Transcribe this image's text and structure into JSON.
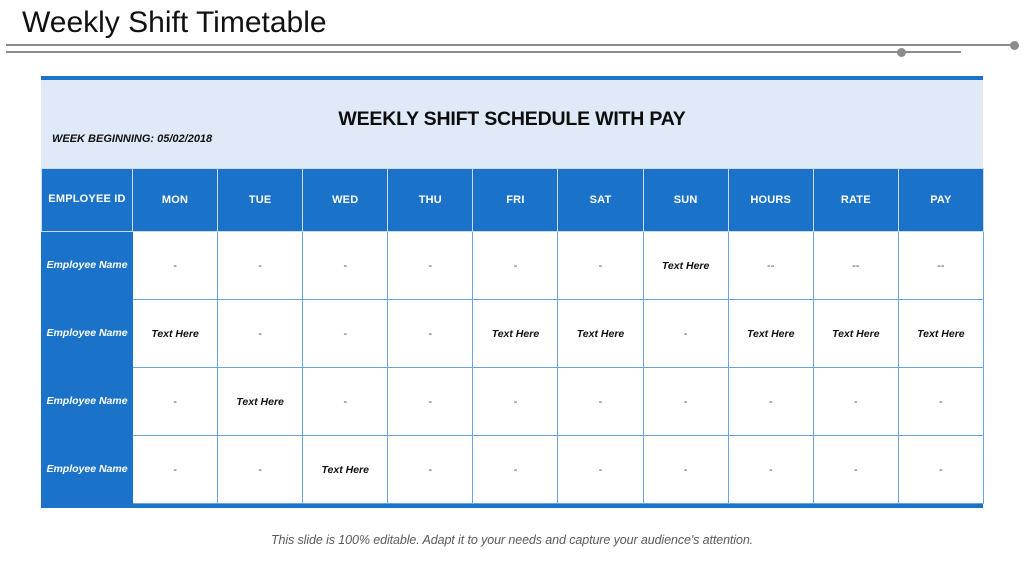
{
  "slide": {
    "title": "Weekly Shift Timetable",
    "footer_note": "This slide is 100% editable. Adapt it to your needs and capture your audience's attention."
  },
  "banner": {
    "heading": "WEEKLY SHIFT SCHEDULE WITH PAY",
    "week_beginning": "WEEK BEGINNING: 05/02/2018"
  },
  "colors": {
    "accent_blue": "#1b73c9",
    "banner_blue": "#dfe9f8",
    "grid_line": "#6ba4dd",
    "rule_gray": "#8c8c8c"
  },
  "table": {
    "headers": [
      "EMPLOYEE ID",
      "MON",
      "TUE",
      "WED",
      "THU",
      "FRI",
      "SAT",
      "SUN",
      "HOURS",
      "RATE",
      "PAY"
    ],
    "rows": [
      {
        "name": "Employee Name",
        "cells": [
          "-",
          "-",
          "-",
          "-",
          "-",
          "-",
          "Text Here",
          "--",
          "--",
          "--"
        ]
      },
      {
        "name": "Employee Name",
        "cells": [
          "Text Here",
          "-",
          "-",
          "-",
          "Text Here",
          "Text Here",
          "-",
          "Text Here",
          "Text Here",
          "Text Here"
        ]
      },
      {
        "name": "Employee Name",
        "cells": [
          "-",
          "Text Here",
          "-",
          "-",
          "-",
          "-",
          "-",
          "-",
          "-",
          "-"
        ]
      },
      {
        "name": "Employee Name",
        "cells": [
          "-",
          "-",
          "Text Here",
          "-",
          "-",
          "-",
          "-",
          "-",
          "-",
          "-"
        ]
      }
    ]
  }
}
